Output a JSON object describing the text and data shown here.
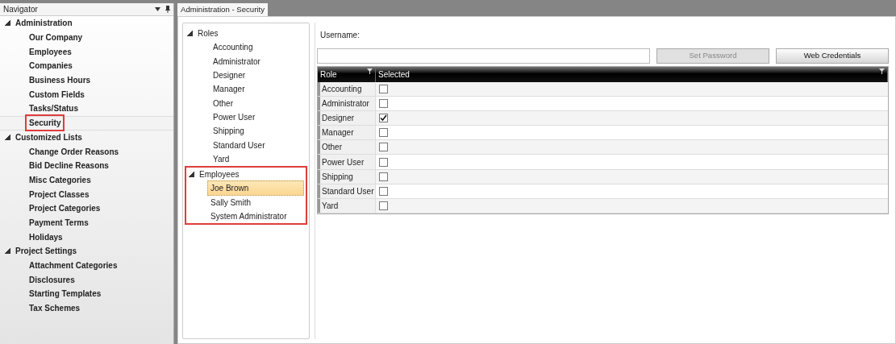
{
  "navigator": {
    "title": "Navigator",
    "groups": [
      {
        "label": "Administration",
        "expanded": true,
        "items": [
          {
            "label": "Our Company",
            "selected": false,
            "highlighted": false
          },
          {
            "label": "Employees",
            "selected": false,
            "highlighted": false
          },
          {
            "label": "Companies",
            "selected": false,
            "highlighted": false
          },
          {
            "label": "Business Hours",
            "selected": false,
            "highlighted": false
          },
          {
            "label": "Custom Fields",
            "selected": false,
            "highlighted": false
          },
          {
            "label": "Tasks/Status",
            "selected": false,
            "highlighted": false
          },
          {
            "label": "Security",
            "selected": true,
            "highlighted": true
          }
        ]
      },
      {
        "label": "Customized Lists",
        "expanded": true,
        "items": [
          {
            "label": "Change Order Reasons",
            "selected": false,
            "highlighted": false
          },
          {
            "label": "Bid Decline Reasons",
            "selected": false,
            "highlighted": false
          },
          {
            "label": "Misc Categories",
            "selected": false,
            "highlighted": false
          },
          {
            "label": "Project Classes",
            "selected": false,
            "highlighted": false
          },
          {
            "label": "Project Categories",
            "selected": false,
            "highlighted": false
          },
          {
            "label": "Payment Terms",
            "selected": false,
            "highlighted": false
          },
          {
            "label": "Holidays",
            "selected": false,
            "highlighted": false
          }
        ]
      },
      {
        "label": "Project Settings",
        "expanded": true,
        "items": [
          {
            "label": "Attachment Categories",
            "selected": false,
            "highlighted": false
          },
          {
            "label": "Disclosures",
            "selected": false,
            "highlighted": false
          },
          {
            "label": "Starting Templates",
            "selected": false,
            "highlighted": false
          },
          {
            "label": "Tax Schemes",
            "selected": false,
            "highlighted": false
          }
        ]
      }
    ]
  },
  "tabs": [
    {
      "label": "Administration - Security",
      "selected": true
    }
  ],
  "tree": {
    "groups": [
      {
        "label": "Roles",
        "expanded": true,
        "children": [
          {
            "label": "Accounting",
            "selected": false
          },
          {
            "label": "Administrator",
            "selected": false
          },
          {
            "label": "Designer",
            "selected": false
          },
          {
            "label": "Manager",
            "selected": false
          },
          {
            "label": "Other",
            "selected": false
          },
          {
            "label": "Power User",
            "selected": false
          },
          {
            "label": "Shipping",
            "selected": false
          },
          {
            "label": "Standard User",
            "selected": false
          },
          {
            "label": "Yard",
            "selected": false
          }
        ]
      },
      {
        "label": "Employees",
        "expanded": true,
        "highlighted": true,
        "children": [
          {
            "label": "Joe Brown",
            "selected": true
          },
          {
            "label": "Sally Smith",
            "selected": false
          },
          {
            "label": "System Administrator",
            "selected": false
          }
        ]
      }
    ]
  },
  "username": {
    "label": "Username:"
  },
  "buttons": [
    {
      "label": "Set Password",
      "disabled": true
    },
    {
      "label": "Web Credentials",
      "disabled": false
    }
  ],
  "grid": {
    "columns": [
      "Role",
      "Selected"
    ],
    "rows": [
      {
        "role": "Accounting",
        "checked": false
      },
      {
        "role": "Administrator",
        "checked": false
      },
      {
        "role": "Designer",
        "checked": true
      },
      {
        "role": "Manager",
        "checked": false
      },
      {
        "role": "Other",
        "checked": false
      },
      {
        "role": "Power User",
        "checked": false
      },
      {
        "role": "Shipping",
        "checked": false
      },
      {
        "role": "Standard User",
        "checked": false
      },
      {
        "role": "Yard",
        "checked": false
      }
    ]
  }
}
